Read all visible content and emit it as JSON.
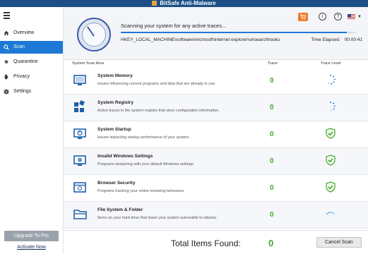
{
  "window": {
    "title": "BitSafe Anti-Malware"
  },
  "sidebar": {
    "items": [
      {
        "label": "Overview",
        "icon": "home-icon"
      },
      {
        "label": "Scan",
        "icon": "magnifier-icon",
        "active": true
      },
      {
        "label": "Quarantine",
        "icon": "quarantine-icon"
      },
      {
        "label": "Privacy",
        "icon": "hand-icon"
      },
      {
        "label": "Settings",
        "icon": "gear-icon"
      }
    ],
    "upgrade_label": "Upgrade To Pro",
    "activate_label": "Activate Now"
  },
  "header": {
    "status_text": "Scanning your system for any active traces...",
    "progress_percent": 96,
    "current_path": "HKEY_LOCAL_MACHINE\\software\\microsoft\\internet explorer\\urlsearchhooks",
    "elapsed_label": "Time Elapsed:",
    "elapsed_value": "00:00:41",
    "icons": [
      "cart-icon",
      "info-icon",
      "help-icon",
      "us-flag-icon",
      "chevron-down-icon"
    ],
    "info_glyph": "i",
    "help_glyph": "?"
  },
  "table": {
    "columns": [
      "System Scan Area",
      "Trace",
      "Trace Level"
    ],
    "rows": [
      {
        "title": "System Memory",
        "desc": "Issues influencing current programs and data that are already in use.",
        "trace": "0",
        "level": "spinner",
        "icon": "monitor-icon"
      },
      {
        "title": "System Registry",
        "desc": "Active traces in the system registry that store configuration information.",
        "trace": "0",
        "level": "spinner",
        "icon": "registry-icon"
      },
      {
        "title": "System Startup",
        "desc": "Issues impacting startup performance of your system.",
        "trace": "0",
        "level": "shield",
        "icon": "startup-icon"
      },
      {
        "title": "Invalid Windows Settings",
        "desc": "Programs tampering with your default Windows settings.",
        "trace": "0",
        "level": "shield",
        "icon": "windows-settings-icon"
      },
      {
        "title": "Browser Security",
        "desc": "Programs tracking your online browsing behaviour.",
        "trace": "0",
        "level": "shield",
        "icon": "browser-icon"
      },
      {
        "title": "File System & Folder",
        "desc": "Items on your hard drive that leave your system vulnerable to attacks.",
        "trace": "0",
        "level": "spinner",
        "icon": "folder-icon"
      }
    ]
  },
  "footer": {
    "total_label": "Total Items Found:",
    "total_value": "0",
    "cancel_label": "Cancel Scan"
  },
  "colors": {
    "accent": "#1e79d6",
    "titlebar": "#1b4f86",
    "trace_green": "#41a82d",
    "cart_orange": "#ee7d2e"
  }
}
